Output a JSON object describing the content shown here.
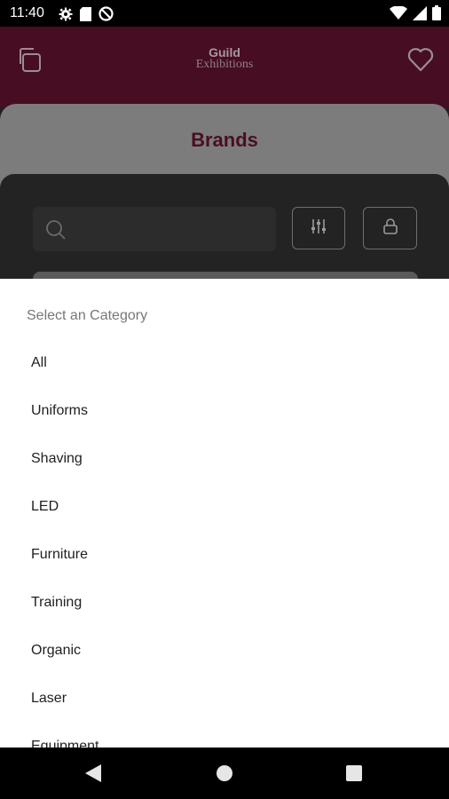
{
  "status_bar": {
    "time": "11:40",
    "icons": [
      "settings-gear-icon",
      "sd-card-icon",
      "do-not-disturb-icon",
      "wifi-icon",
      "cell-signal-icon",
      "battery-icon"
    ]
  },
  "header": {
    "logo_line1": "Guild",
    "logo_line2": "Exhibitions",
    "left_icon": "copy-icon",
    "right_icon": "heart-icon",
    "background_color": "#470d22"
  },
  "brands_section": {
    "title": "Brands",
    "search": {
      "placeholder": "",
      "icon": "search-icon"
    },
    "filter_icon": "sliders-icon",
    "bag_icon": "bag-icon"
  },
  "category_sheet": {
    "title": "Select an Category",
    "items": [
      "All",
      "Uniforms",
      "Shaving",
      "LED",
      "Furniture",
      "Training",
      "Organic",
      "Laser",
      "Equipment"
    ]
  },
  "nav_bar": {
    "icons": [
      "back-icon",
      "home-icon",
      "recents-icon"
    ]
  },
  "colors": {
    "accent": "#6b1030",
    "sheet_bg": "#ffffff",
    "text_primary": "#1f1f1f",
    "text_secondary": "#777777"
  }
}
